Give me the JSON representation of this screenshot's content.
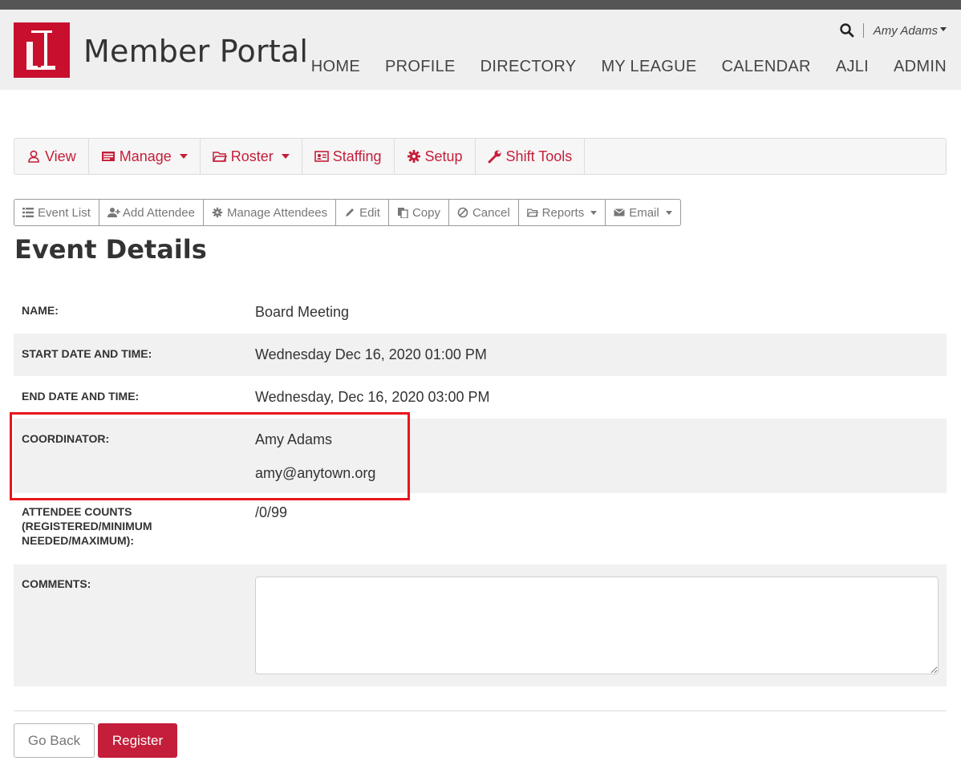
{
  "header": {
    "brand": "Member Portal",
    "user_name": "Amy Adams",
    "nav": [
      "HOME",
      "PROFILE",
      "DIRECTORY",
      "MY LEAGUE",
      "CALENDAR",
      "AJLI",
      "ADMIN"
    ]
  },
  "toolbar_primary": {
    "view": "View",
    "manage": "Manage",
    "roster": "Roster",
    "staffing": "Staffing",
    "setup": "Setup",
    "shift_tools": "Shift Tools"
  },
  "toolbar_secondary": {
    "event_list": "Event List",
    "add_attendee": "Add Attendee",
    "manage_attendees": "Manage Attendees",
    "edit": "Edit",
    "copy": "Copy",
    "cancel": "Cancel",
    "reports": "Reports",
    "email": "Email"
  },
  "page_title": "Event Details",
  "details": {
    "name_label": "NAME:",
    "name_value": "Board Meeting",
    "start_label": "START DATE AND TIME:",
    "start_value": "Wednesday Dec 16, 2020 01:00 PM",
    "end_label": "END DATE AND TIME:",
    "end_value": "Wednesday, Dec 16, 2020 03:00 PM",
    "coordinator_label": "COORDINATOR:",
    "coordinator_name": "Amy Adams",
    "coordinator_email": "amy@anytown.org",
    "counts_label": "ATTENDEE COUNTS (REGISTERED/MINIMUM NEEDED/MAXIMUM):",
    "counts_value": "/0/99",
    "comments_label": "COMMENTS:",
    "comments_value": ""
  },
  "actions": {
    "go_back": "Go Back",
    "register": "Register"
  },
  "colors": {
    "brand_red": "#c41e3a",
    "highlight_red": "#e8161c",
    "header_bg": "#efefef"
  },
  "icons": {
    "logo": "jl-logo",
    "search": "search-icon",
    "view": "user-icon",
    "manage": "id-card-icon",
    "roster": "folder-icon",
    "staffing": "address-card-icon",
    "setup": "gear-icon",
    "shift_tools": "wrench-icon",
    "event_list": "list-icon",
    "add_attendee": "user-plus-icon",
    "manage_attendees": "gear-icon",
    "edit": "pencil-icon",
    "copy": "copy-icon",
    "cancel": "ban-icon",
    "reports": "folder-icon",
    "email": "envelope-icon"
  }
}
